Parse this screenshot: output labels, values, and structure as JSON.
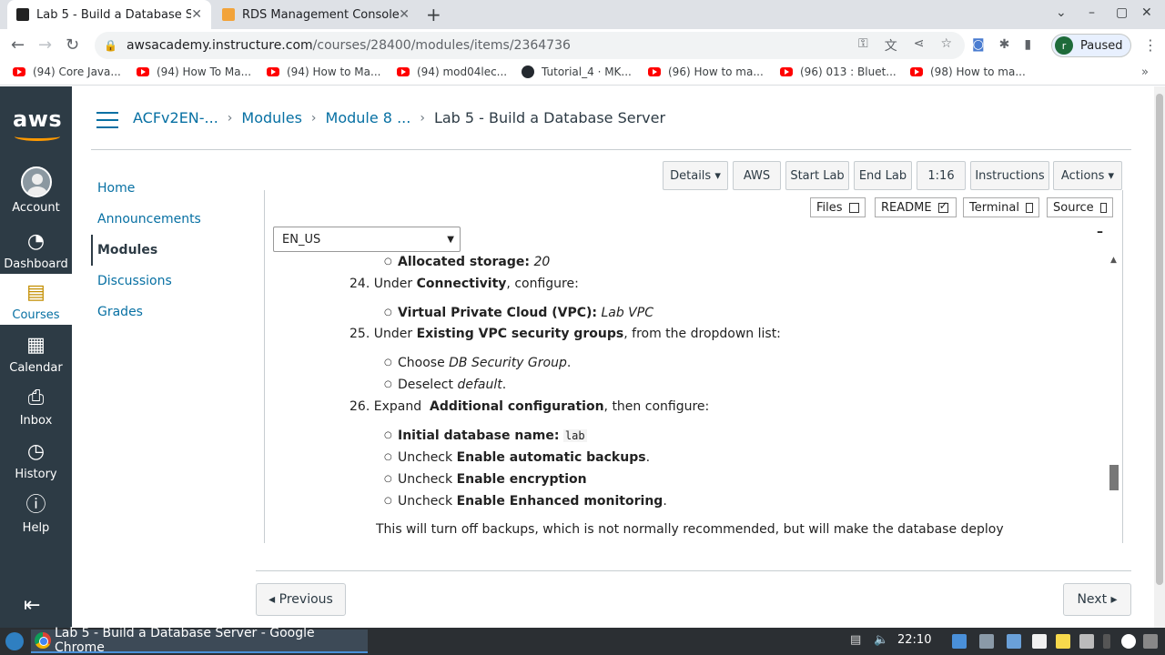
{
  "browser": {
    "tabs": [
      {
        "title": "Lab 5 - Build a Database Se",
        "active": true
      },
      {
        "title": "RDS Management Console",
        "active": false
      }
    ],
    "url_host": "awsacademy.instructure.com",
    "url_path": "/courses/28400/modules/items/2364736",
    "profile_initial": "r",
    "profile_status": "Paused",
    "bookmarks": [
      "(94) Core Java...",
      "(94) How To Ma...",
      "(94) How to Ma...",
      "(94) mod04lec...",
      "Tutorial_4 · MK...",
      "(96) How to ma...",
      "(96) 013 : Bluet...",
      "(98) How to ma..."
    ]
  },
  "global_nav": {
    "logo": "aws",
    "items": [
      {
        "label": "Account",
        "icon": "user-icon"
      },
      {
        "label": "Dashboard",
        "icon": "dashboard-icon"
      },
      {
        "label": "Courses",
        "icon": "book-icon"
      },
      {
        "label": "Calendar",
        "icon": "calendar-icon"
      },
      {
        "label": "Inbox",
        "icon": "inbox-icon"
      },
      {
        "label": "History",
        "icon": "clock-icon"
      },
      {
        "label": "Help",
        "icon": "help-icon"
      }
    ]
  },
  "breadcrumb": {
    "course": "ACFv2EN-...",
    "modules": "Modules",
    "module": "Module 8 ...",
    "current": "Lab 5 - Build a Database Server"
  },
  "course_nav": [
    "Home",
    "Announcements",
    "Modules",
    "Discussions",
    "Grades"
  ],
  "lab_buttons": {
    "details": "Details ▾",
    "aws": "AWS",
    "start": "Start Lab",
    "end": "End Lab",
    "timer": "1:16",
    "instructions": "Instructions",
    "actions": "Actions ▾"
  },
  "toggles": {
    "files": "Files",
    "readme": "README",
    "terminal": "Terminal",
    "source": "Source"
  },
  "language": "EN_US",
  "instructions": {
    "storage_label": "Allocated storage:",
    "storage_value": "20",
    "step24_num": "24.",
    "step24_a": "Under",
    "step24_b": "Connectivity",
    "step24_c": ", configure:",
    "vpc_label": "Virtual Private Cloud (VPC):",
    "vpc_value": "Lab VPC",
    "step25_num": "25.",
    "step25_a": "Under",
    "step25_b": "Existing VPC security groups",
    "step25_c": ", from the dropdown list:",
    "choose_a": "Choose",
    "choose_b": "DB Security Group",
    "choose_c": ".",
    "deselect_a": "Deselect",
    "deselect_b": "default",
    "deselect_c": ".",
    "step26_num": "26.",
    "step26_a": "Expand",
    "step26_b": "Additional configuration",
    "step26_c": ", then configure:",
    "dbname_label": "Initial database name:",
    "dbname_value": "lab",
    "uncheck": "Uncheck",
    "backups": "Enable automatic backups",
    "backups_end": ".",
    "encryption": "Enable encryption",
    "monitoring": "Enable Enhanced monitoring",
    "monitoring_end": ".",
    "note": "This will turn off backups, which is not normally recommended, but will make the database deploy"
  },
  "pager": {
    "previous": "◂ Previous",
    "next": "Next ▸"
  },
  "taskbar": {
    "task": "Lab 5 - Build a Database Server - Google Chrome",
    "clock": "22:10"
  }
}
